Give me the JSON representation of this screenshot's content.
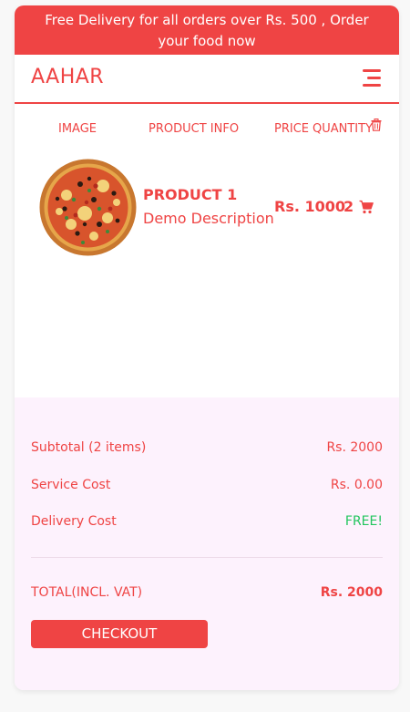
{
  "promo_banner": "Free Delivery for all orders over Rs. 500 , Order your food now",
  "navbar": {
    "brand": "AAHAR",
    "menu_icon": "hamburger-menu-icon"
  },
  "cart_table": {
    "columns": [
      "IMAGE",
      "PRODUCT INFO",
      "PRICE",
      "QUANTITY"
    ],
    "delete_icon": "trash-icon",
    "items": [
      {
        "name": "PRODUCT 1",
        "description": "Demo Description",
        "price": "Rs. 1000",
        "quantity": "2",
        "image_icon": "pizza-image",
        "action_icon": "cart-icon"
      }
    ]
  },
  "summary": {
    "subtotal_label": "Subtotal (2 items)",
    "subtotal_value": "Rs. 2000",
    "service_label": "Service Cost",
    "service_value": "Rs. 0.00",
    "delivery_label": "Delivery Cost",
    "delivery_value": "FREE!",
    "total_label": "TOTAL(INCL. VAT)",
    "total_value": "Rs. 2000",
    "checkout_label": "CHECKOUT"
  },
  "colors": {
    "accent": "#ef4444",
    "free": "#22c55e",
    "summary_bg": "#fdf2fd"
  }
}
